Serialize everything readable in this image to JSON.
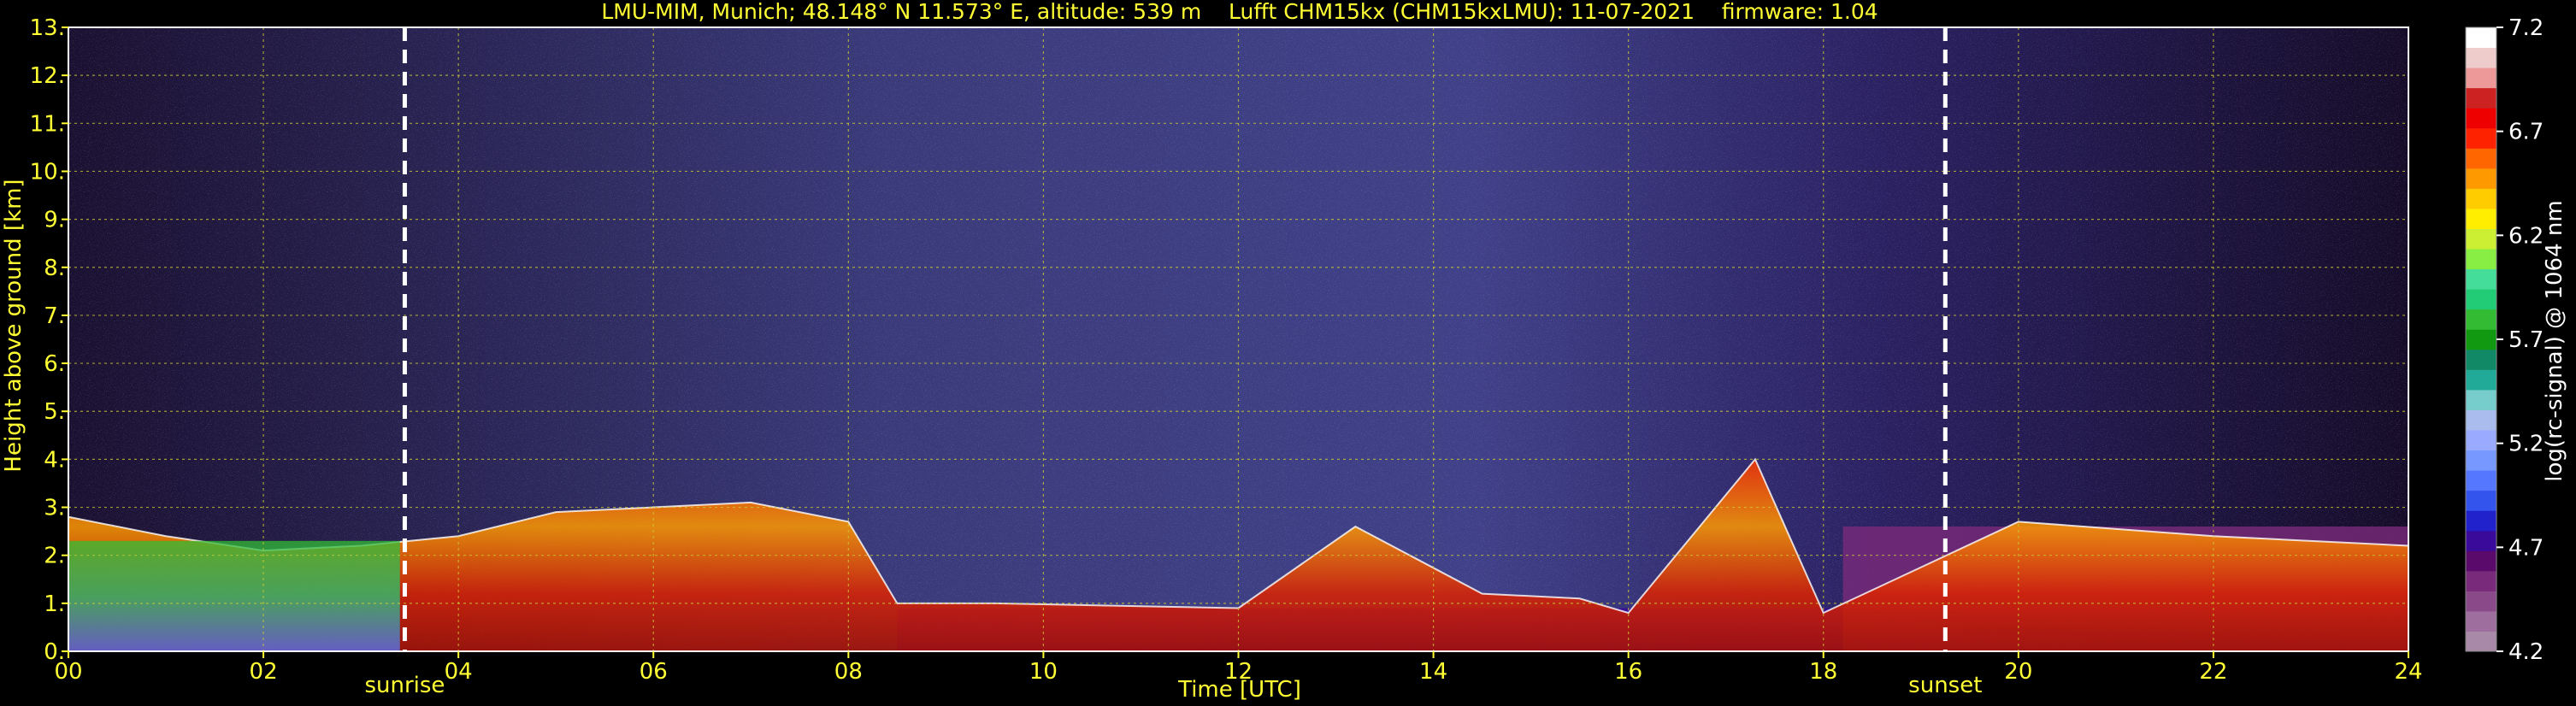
{
  "chart_data": {
    "type": "heatmap",
    "title": "LMU-MIM, Munich; 48.148° N 11.573° E, altitude: 539 m    Lufft CHM15kx (CHM15kxLMU): 11-07-2021    firmware: 1.04",
    "xlabel": "Time [UTC]",
    "ylabel": "Height above ground [km]",
    "colorbar_label": "log(rc-signal) @ 1064 nm",
    "xlim": [
      0,
      24
    ],
    "ylim": [
      0,
      13
    ],
    "x_ticks": [
      "00",
      "02",
      "04",
      "06",
      "08",
      "10",
      "12",
      "14",
      "16",
      "18",
      "20",
      "22",
      "24"
    ],
    "y_ticks": [
      "0.",
      "1.",
      "2.",
      "3.",
      "4.",
      "5.",
      "6.",
      "7.",
      "8.",
      "9.",
      "10.",
      "11.",
      "12.",
      "13."
    ],
    "colorbar_range": [
      4.2,
      7.2
    ],
    "colorbar_ticks": [
      "4.2",
      "4.7",
      "5.2",
      "5.7",
      "6.2",
      "6.7",
      "7.2"
    ],
    "colorbar_colors": [
      "#a88aa8",
      "#9e6e9e",
      "#8a4a8a",
      "#7a2a7a",
      "#5a0a6a",
      "#3a0a9a",
      "#2222cc",
      "#3355ee",
      "#5577ff",
      "#7799ff",
      "#99aaff",
      "#aabbee",
      "#77cccc",
      "#22aa99",
      "#118866",
      "#119911",
      "#33bb33",
      "#22cc77",
      "#44dd99",
      "#88ee44",
      "#ccee33",
      "#ffee00",
      "#ffcc00",
      "#ff9900",
      "#ff6600",
      "#ff2200",
      "#ee0000",
      "#cc2222",
      "#ee9999",
      "#eecccc",
      "#ffffff"
    ],
    "grid": true,
    "annotations": [
      {
        "label": "sunrise",
        "x": 3.45
      },
      {
        "label": "sunset",
        "x": 19.25
      }
    ],
    "layer_top_km": [
      {
        "t": 0.0,
        "h": 2.8
      },
      {
        "t": 1.0,
        "h": 2.4
      },
      {
        "t": 2.0,
        "h": 2.1
      },
      {
        "t": 3.0,
        "h": 2.2
      },
      {
        "t": 4.0,
        "h": 2.4
      },
      {
        "t": 5.0,
        "h": 2.9
      },
      {
        "t": 6.0,
        "h": 3.0
      },
      {
        "t": 7.0,
        "h": 3.1
      },
      {
        "t": 8.0,
        "h": 2.7
      },
      {
        "t": 8.5,
        "h": 1.0
      },
      {
        "t": 9.5,
        "h": 1.0
      },
      {
        "t": 12.0,
        "h": 0.9
      },
      {
        "t": 13.2,
        "h": 2.6
      },
      {
        "t": 14.5,
        "h": 1.2
      },
      {
        "t": 15.5,
        "h": 1.1
      },
      {
        "t": 16.0,
        "h": 0.8
      },
      {
        "t": 17.3,
        "h": 4.0
      },
      {
        "t": 18.0,
        "h": 0.8
      },
      {
        "t": 20.0,
        "h": 2.7
      },
      {
        "t": 22.0,
        "h": 2.4
      },
      {
        "t": 24.0,
        "h": 2.2
      }
    ]
  }
}
